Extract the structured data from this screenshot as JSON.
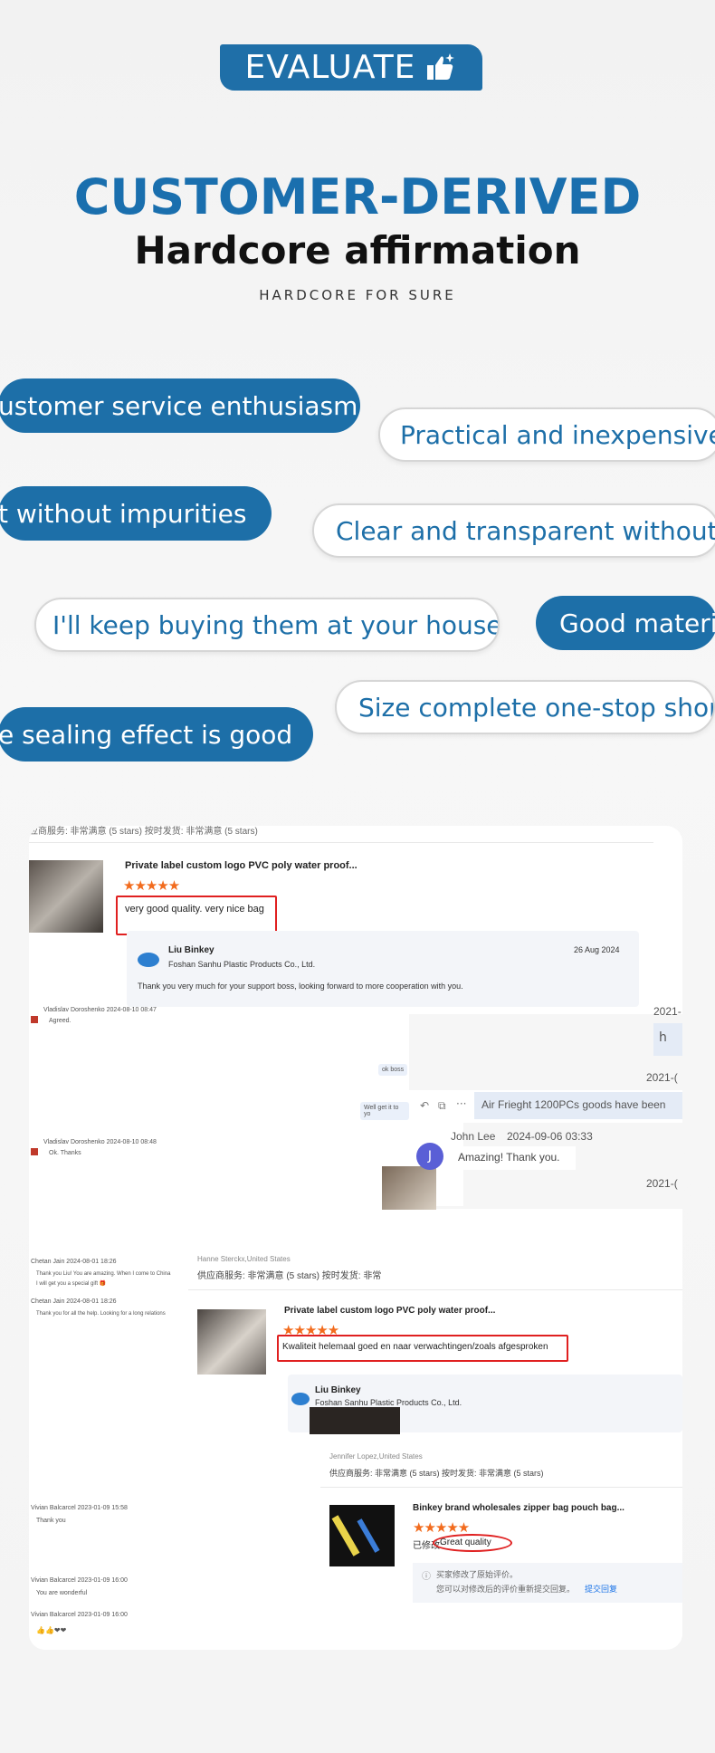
{
  "header": {
    "badge_label": "EVALUATE",
    "badge_icon": "thumbs-up-sparkle-icon",
    "title_main": "CUSTOMER-DERIVED",
    "title_sub": "Hardcore affirmation",
    "tagline": "HARDCORE FOR SURE"
  },
  "colors": {
    "brand_blue": "#1d6fa8",
    "star_orange": "#f26b1d",
    "highlight_red": "#e02020"
  },
  "pills": [
    {
      "text": "ustomer service enthusiasm",
      "style": "blue"
    },
    {
      "text": "Practical and inexpensive",
      "style": "white"
    },
    {
      "text": "t without impurities",
      "style": "blue"
    },
    {
      "text": "Clear and transparent without",
      "style": "white"
    },
    {
      "text": "I'll keep buying them at your house",
      "style": "white"
    },
    {
      "text": "Good materi",
      "style": "blue"
    },
    {
      "text": "Size complete one-stop shop",
      "style": "white"
    },
    {
      "text": "e sealing effect is good",
      "style": "blue"
    }
  ],
  "reviews": {
    "top_rating_strip": "应商服务: 非常满意 (5 stars)        按时发货: 非常满意 (5 stars)",
    "review1": {
      "product_title": "Private label custom logo PVC poly water proof...",
      "stars": 5,
      "comment": "very good quality.  very nice bag",
      "reply_name": "Liu Binkey",
      "reply_company": "Foshan Sanhu Plastic Products Co., Ltd.",
      "reply_date": "26 Aug 2024",
      "reply_text": "Thank you very much for your support boss, looking forward to more cooperation with you."
    },
    "chat1": {
      "header": "Vladislav Doroshenko  2024-08-10 08:47",
      "msg1": "Agreed.",
      "bubble1": "ok boss",
      "bubble2": "Well get it to yo",
      "header2": "Vladislav Doroshenko  2024-08-10 08:48",
      "msg2": "Ok. Thanks"
    },
    "chat2": {
      "year1": "2021-",
      "bubble_h": "h",
      "year2": "2021-(",
      "freight": "Air Frieght 1200PCs goods have been",
      "name": "John Lee",
      "time": "2024-09-06 03:33",
      "message": "Amazing! Thank you.",
      "avatar_letter": "J",
      "year3": "2021-("
    },
    "chat3": {
      "h1": "Chetan Jain  2024-08-01 18:26",
      "m1": "Thank you Liu! You are amazing. When I come to China",
      "m1b": "I will get you a special gift 🎁",
      "h2": "Chetan Jain  2024-08-01 18:26",
      "m2": "Thank you for all the help. Looking for a long relations"
    },
    "review2": {
      "reviewer": "Hanne Sterckx,United States",
      "rating_strip": "供应商服务: 非常满意 (5 stars)        按时发货: 非常",
      "product_title": "Private label custom logo PVC poly water proof...",
      "stars": 5,
      "comment": "Kwaliteit helemaal goed en naar verwachtingen/zoals afgesproken",
      "reply_name": "Liu Binkey",
      "reply_company": "Foshan Sanhu Plastic Products Co., Ltd."
    },
    "chat4": {
      "h1": "Vivian Balcarcel  2023-01-09 15:58",
      "m1": "Thank you",
      "h2": "Vivian Balcarcel  2023-01-09 16:00",
      "m2": "You are wonderful",
      "h3": "Vivian Balcarcel  2023-01-09 16:00",
      "m3": "👍👍❤❤"
    },
    "review3": {
      "reviewer": "Jennifer Lopez,United States",
      "rating_strip": "供应商服务: 非常满意  (5 stars)        按时发货: 非常满意  (5 stars)",
      "product_title": "Binkey brand wholesales zipper bag pouch bag...",
      "stars": 5,
      "comment_prefix": "已修改:",
      "comment": "Great quality",
      "note1": "买家修改了原始评价。",
      "note2": "您可以对修改后的评价重新提交回复。",
      "note_link": "提交回复"
    }
  }
}
